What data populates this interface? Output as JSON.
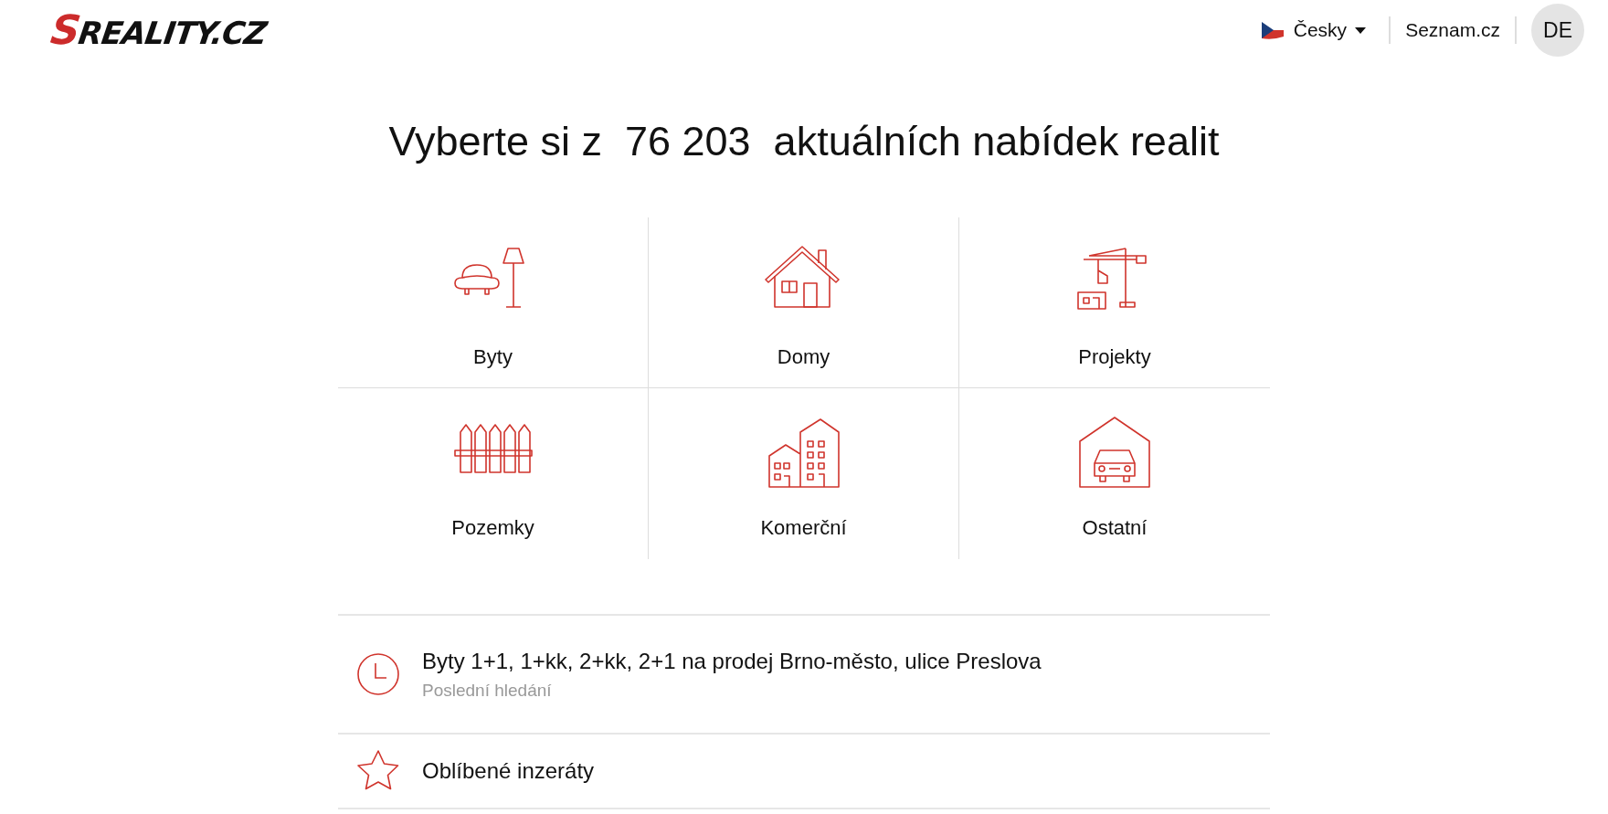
{
  "header": {
    "logo": "SREALITY.CZ",
    "language": {
      "label": "Česky"
    },
    "portal_link": "Seznam.cz",
    "user_initials": "DE"
  },
  "headline": "Vyberte si z  76 203  aktuálních nabídek realit",
  "categories": [
    {
      "kind": "flat",
      "label": "Byty"
    },
    {
      "kind": "house",
      "label": "Domy"
    },
    {
      "kind": "project",
      "label": "Projekty"
    },
    {
      "kind": "land",
      "label": "Pozemky"
    },
    {
      "kind": "commercial",
      "label": "Komerční"
    },
    {
      "kind": "other",
      "label": "Ostatní"
    }
  ],
  "shortcuts": [
    {
      "kind": "recent",
      "title": "Byty 1+1, 1+kk, 2+kk, 2+1 na prodej Brno-město, ulice Preslova",
      "subtitle": "Poslední hledání"
    },
    {
      "kind": "favorites",
      "title": "Oblíbené inzeráty"
    }
  ]
}
